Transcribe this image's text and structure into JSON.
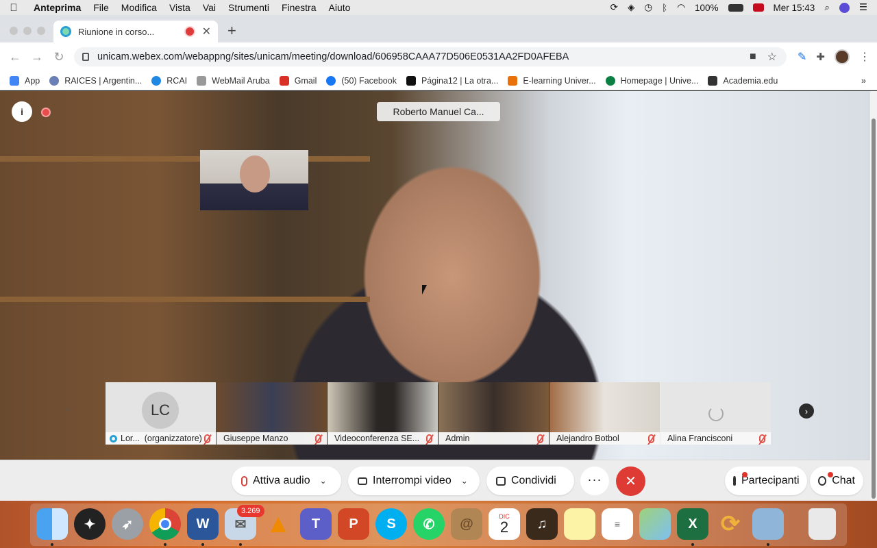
{
  "menubar": {
    "app": "Anteprima",
    "items": [
      "File",
      "Modifica",
      "Vista",
      "Vai",
      "Strumenti",
      "Finestra",
      "Aiuto"
    ],
    "battery": "100%",
    "clock": "Mer 15:43"
  },
  "browser": {
    "tab_title": "Riunione in corso...",
    "url": "unicam.webex.com/webappng/sites/unicam/meeting/download/606958CAAA77D506E0531AA2FD0AFEBA",
    "bookmarks": [
      {
        "label": "App",
        "color": "#4285f4"
      },
      {
        "label": "RAICES | Argentin...",
        "color": "#6a7fb5"
      },
      {
        "label": "RCAI",
        "color": "#1e88e5"
      },
      {
        "label": "WebMail Aruba",
        "color": "#999999"
      },
      {
        "label": "Gmail",
        "color": "#d93025"
      },
      {
        "label": "(50) Facebook",
        "color": "#1877f2"
      },
      {
        "label": "Página12 | La otra...",
        "color": "#111111"
      },
      {
        "label": "E-learning Univer...",
        "color": "#e8710a"
      },
      {
        "label": "Homepage | Unive...",
        "color": "#0b8043"
      },
      {
        "label": "Academia.edu",
        "color": "#333333"
      }
    ],
    "overflow": "»"
  },
  "meeting": {
    "active_speaker": "Roberto Manuel Ca...",
    "participants": [
      {
        "name": "Lor...",
        "extra": "(organizzatore)",
        "initials": "LC",
        "kind": "initials"
      },
      {
        "name": "Giuseppe Manzo",
        "extra": "",
        "kind": "video"
      },
      {
        "name": "Videoconferenza SE...",
        "extra": "",
        "kind": "video"
      },
      {
        "name": "Admin",
        "extra": "",
        "kind": "video"
      },
      {
        "name": "Alejandro Botbol",
        "extra": "",
        "kind": "video"
      },
      {
        "name": "Alina Francisconi",
        "extra": "",
        "kind": "loading"
      }
    ],
    "controls": {
      "audio": "Attiva audio",
      "video": "Interrompi video",
      "share": "Condividi",
      "more": "···",
      "leave": "✕",
      "participants": "Partecipanti",
      "chat": "Chat"
    }
  },
  "dock": {
    "mail_badge": "3.269",
    "calendar_month": "DIC",
    "calendar_day": "2",
    "apps": [
      "Finder",
      "Compass",
      "Launchpad",
      "Chrome",
      "Word",
      "Mail",
      "VLC",
      "Teams",
      "PowerPoint",
      "Skype",
      "WhatsApp",
      "Contacts",
      "Calendar",
      "GarageBand",
      "Notes",
      "Reminders",
      "Maps",
      "Excel",
      "Sync",
      "Preview",
      "Trash"
    ]
  }
}
